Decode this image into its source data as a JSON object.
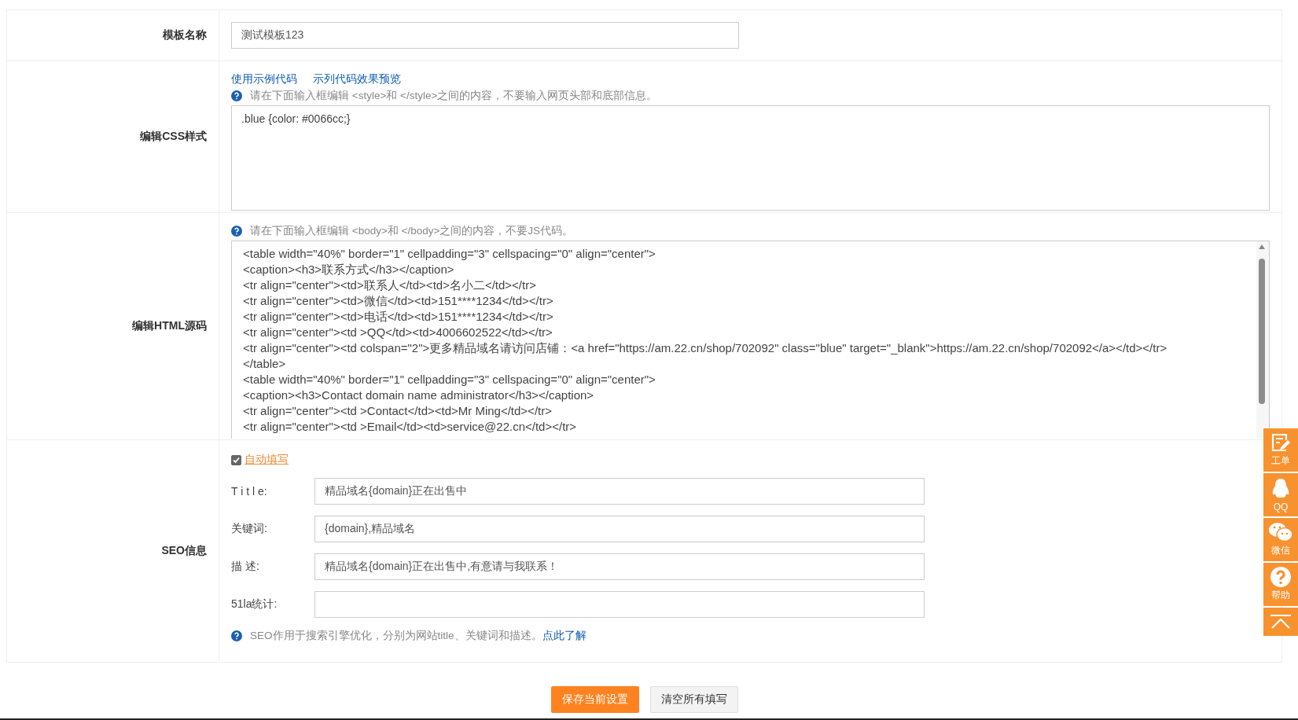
{
  "form": {
    "rows": [
      {
        "kind": "name",
        "label": "模板名称",
        "value": "测试模板123"
      },
      {
        "kind": "css",
        "label": "编辑CSS样式",
        "links": [
          "使用示例代码",
          "示列代码效果预览"
        ],
        "hint": "请在下面输入框编辑 <style>和 </style>之间的内容，不要输入网页头部和底部信息。",
        "value": ".blue {color: #0066cc;}"
      },
      {
        "kind": "html",
        "label": "编辑HTML源码",
        "hint": "请在下面输入框编辑 <body>和 </body>之间的内容，不要JS代码。",
        "lines": [
          "<table width=\"40%\" border=\"1\" cellpadding=\"3\" cellspacing=\"0\" align=\"center\">",
          "<caption><h3>联系方式</h3></caption>",
          "<tr align=\"center\"><td>联系人</td><td>名小二</td></tr>",
          "<tr align=\"center\"><td>微信</td><td>151****1234</td></tr>",
          "<tr align=\"center\"><td>电话</td><td>151****1234</td></tr>",
          "<tr align=\"center\"><td >QQ</td><td>4006602522</td></tr>",
          "<tr align=\"center\"><td colspan=\"2\">更多精品域名请访问店铺：<a href=\"https://am.22.cn/shop/702092\" class=\"blue\" target=\"_blank\">https://am.22.cn/shop/702092</a></td></tr>",
          "</table>",
          "<table width=\"40%\" border=\"1\" cellpadding=\"3\" cellspacing=\"0\" align=\"center\">",
          "<caption><h3>Contact domain name administrator</h3></caption>",
          "<tr align=\"center\"><td >Contact</td><td>Mr Ming</td></tr>",
          "<tr align=\"center\"><td >Email</td><td>service@22.cn</td></tr>"
        ]
      },
      {
        "kind": "seo",
        "label": "SEO信息",
        "auto_fill": {
          "label": "自动填写",
          "checked": true
        },
        "fields": [
          {
            "label": "T i t l e:",
            "value": "精品域名{domain}正在出售中"
          },
          {
            "label": "关键词:",
            "value": "{domain},精品域名"
          },
          {
            "label": "描 述:",
            "value": "精品域名{domain}正在出售中,有意请与我联系！"
          },
          {
            "label": "51la统计:"
          }
        ],
        "hint": "SEO作用于搜索引擎优化，分别为网站title、关键词和描述。",
        "hint_link": "点此了解"
      }
    ]
  },
  "buttons": [
    {
      "kind": "primary",
      "label": "保存当前设置"
    },
    {
      "kind": "secondary",
      "label": "清空所有填写"
    }
  ],
  "side_tools": [
    {
      "kind": "ticket",
      "label": "工单"
    },
    {
      "kind": "qq",
      "label": "QQ"
    },
    {
      "kind": "wechat",
      "label": "微信"
    },
    {
      "kind": "help",
      "label": "帮助"
    },
    {
      "kind": "top"
    }
  ]
}
